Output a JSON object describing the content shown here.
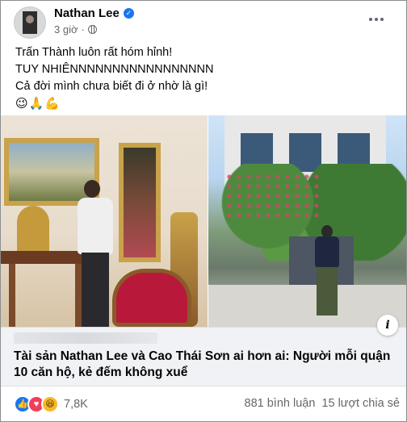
{
  "post": {
    "author": "Nathan Lee",
    "time": "3 giờ",
    "privacy_icon": "globe-icon",
    "text_lines": [
      "Trấn Thành luôn rất hóm hỉnh!",
      "TUY NHIÊNNNNNNNNNNNNNNNNN",
      "Cả đời mình chưa biết đi ở nhờ là gì!"
    ],
    "emojis": "😉🙏💪"
  },
  "link_preview": {
    "title": "Tài sản Nathan Lee và Cao Thái Sơn ai hơn ai: Người mỗi quận 10 căn hộ, kẻ đếm không xuể",
    "info_label": "i"
  },
  "footer": {
    "reactions": [
      "like",
      "love",
      "haha"
    ],
    "reaction_count": "7,8K",
    "comments": "881 bình luận",
    "shares": "15 lượt chia sẻ"
  },
  "colors": {
    "brand_blue": "#1877f2",
    "secondary_text": "#65676b",
    "link_bg": "#f0f2f5"
  }
}
